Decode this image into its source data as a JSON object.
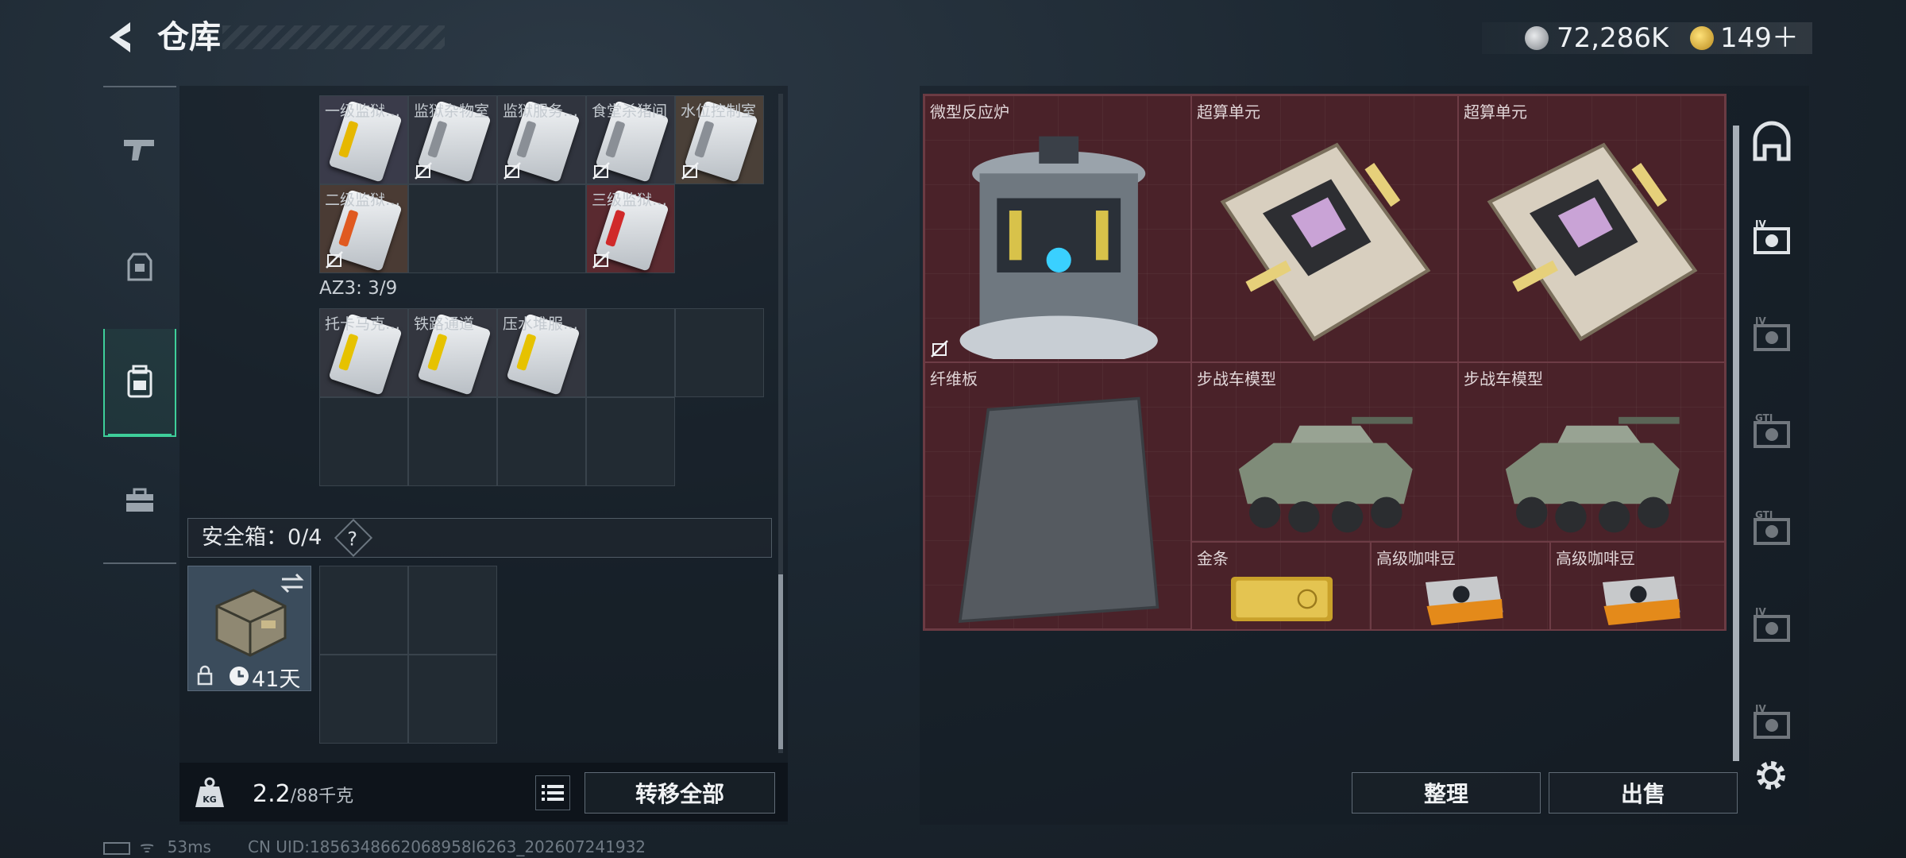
{
  "header": {
    "title": "仓库",
    "currency1": "72,286K",
    "currency2": "149＋"
  },
  "nav": {
    "items": [
      "weapon-icon",
      "armor-icon",
      "backpack-icon",
      "toolbox-icon"
    ],
    "active": 2
  },
  "left": {
    "keycards": [
      {
        "label": "一级监狱…",
        "color": "#e6b800",
        "bg": "#3a3b4a",
        "flag": false
      },
      {
        "label": "监狱杂物室",
        "color": "#8a8f96",
        "bg": "#30343e",
        "flag": true
      },
      {
        "label": "监狱服务…",
        "color": "#8a8f96",
        "bg": "#30343e",
        "flag": true
      },
      {
        "label": "食堂杀猪间",
        "color": "#8a8f96",
        "bg": "#30343e",
        "flag": true
      },
      {
        "label": "水位控制室",
        "color": "#8a8f96",
        "bg": "#4a4038",
        "flag": true
      },
      {
        "label": "二级监狱…",
        "color": "#e05a20",
        "bg": "#4a3b34",
        "flag": true
      },
      {
        "label": "三级监狱…",
        "color": "#d02a2a",
        "bg": "#5a2a30",
        "flag": true
      }
    ],
    "az3_label": "AZ3: 3/9",
    "az3_cards": [
      {
        "label": "托卡马克…",
        "color": "#e6c200"
      },
      {
        "label": "铁路通道",
        "color": "#e6c200"
      },
      {
        "label": "压水堆服…",
        "color": "#e6c200"
      }
    ],
    "safe_label": "安全箱：0/4",
    "safe_help": "?",
    "safe_days": "41天",
    "weight_value": "2.2",
    "weight_max": "/88千克",
    "transfer_all": "转移全部"
  },
  "right": {
    "items": [
      {
        "name": "微型反应炉",
        "type": "reactor"
      },
      {
        "name": "超算单元",
        "type": "board"
      },
      {
        "name": "超算单元",
        "type": "board"
      },
      {
        "name": "纤维板",
        "type": "fiber"
      },
      {
        "name": "步战车模型",
        "type": "vehicle"
      },
      {
        "name": "步战车模型",
        "type": "vehicle"
      },
      {
        "name": "金条",
        "type": "gold"
      },
      {
        "name": "高级咖啡豆",
        "type": "coffee"
      },
      {
        "name": "高级咖啡豆",
        "type": "coffee"
      }
    ],
    "sort_label": "整理",
    "sell_label": "出售"
  },
  "right_nav": [
    "shelter-icon",
    "IV-icon",
    "IV-icon",
    "GTI-icon",
    "GTI-icon",
    "IV-icon",
    "IV-icon"
  ],
  "status": {
    "ping": "53ms",
    "uid": "CN UID:1856348662068958I6263_202607241932"
  },
  "colors": {
    "accent": "#3ecf9a",
    "grid_bg": "#4a2229"
  }
}
